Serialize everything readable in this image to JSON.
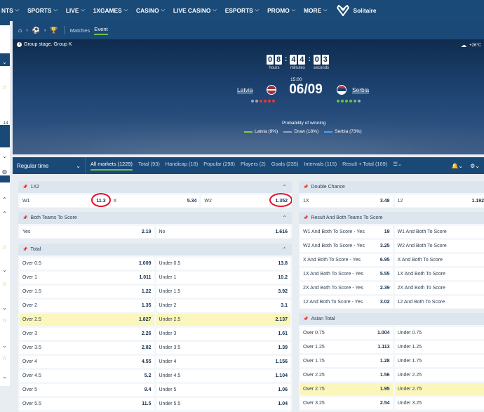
{
  "nav": {
    "items": [
      {
        "label": "NTS",
        "chev": "v"
      },
      {
        "label": "SPORTS",
        "chev": "v"
      },
      {
        "label": "LIVE",
        "chev": "v"
      },
      {
        "label": "1XGAMES",
        "chev": "v"
      },
      {
        "label": "CASINO",
        "chev": "v"
      },
      {
        "label": "LIVE CASINO",
        "chev": "v"
      },
      {
        "label": "ESPORTS",
        "chev": "v"
      },
      {
        "label": "PROMO",
        "chev": "v"
      },
      {
        "label": "MORE",
        "chev": "v"
      }
    ],
    "logo_label": "Solitaire"
  },
  "leftbar": {
    "badge": ".14"
  },
  "breadcrumb": {
    "home_icon": "home-icon",
    "ball_icon": "soccer-ball-icon",
    "trophy_icon": "trophy-icon",
    "tabs": [
      "Matches",
      "Event"
    ]
  },
  "event": {
    "group": "Group stage. Group K",
    "weather": "+26°C",
    "clock": {
      "hours": [
        "0",
        "8"
      ],
      "minutes": [
        "4",
        "4"
      ],
      "seconds": [
        "0",
        "3"
      ],
      "labels": [
        "hours",
        "minutes",
        "seconds"
      ]
    },
    "kickoff": "15:00",
    "home": "Latvia",
    "away": "Serbia",
    "date": "06/09",
    "probability_title": "Probability of winning",
    "legend": [
      {
        "label": "Latvia (9%)",
        "color": "#8bc34a"
      },
      {
        "label": "Draw (18%)",
        "color": "#90a4c4"
      },
      {
        "label": "Serbia (73%)",
        "color": "#42a5f5"
      }
    ],
    "home_form": [
      "#9aa9ba",
      "#9aa9ba",
      "#e53935",
      "#e53935",
      "#e53935",
      "#e53935"
    ],
    "away_form": [
      "#6dc04b",
      "#6dc04b",
      "#6dc04b",
      "#6dc04b",
      "#6dc04b",
      "#9aa9ba"
    ]
  },
  "market_bar": {
    "period": "Regular time",
    "tabs": [
      "All markets (1229)",
      "Total (93)",
      "Handicap (18)",
      "Popular (298)",
      "Players (2)",
      "Goals (235)",
      "Intervals (115)",
      "Result + Total (169)"
    ]
  },
  "panels": {
    "x12": {
      "title": "1X2",
      "cells": [
        [
          "W1",
          "11.3"
        ],
        [
          "X",
          "5.34"
        ],
        [
          "W2",
          "1.352"
        ]
      ]
    },
    "btts": {
      "title": "Both Teams To Score",
      "cells": [
        [
          "Yes",
          "2.19"
        ],
        [
          "No",
          "1.616"
        ]
      ]
    },
    "total": {
      "title": "Total",
      "rows": [
        [
          [
            "Over 0.5",
            "1.009"
          ],
          [
            "Under 0.5",
            "13.8"
          ]
        ],
        [
          [
            "Over 1",
            "1.011"
          ],
          [
            "Under 1",
            "10.2"
          ]
        ],
        [
          [
            "Over 1.5",
            "1.22"
          ],
          [
            "Under 1.5",
            "3.92"
          ]
        ],
        [
          [
            "Over 2",
            "1.35"
          ],
          [
            "Under 2",
            "3.1"
          ]
        ],
        [
          [
            "Over 2.5",
            "1.827"
          ],
          [
            "Under 2.5",
            "2.137"
          ]
        ],
        [
          [
            "Over 3",
            "2.26"
          ],
          [
            "Under 3",
            "1.61"
          ]
        ],
        [
          [
            "Over 3.5",
            "2.82"
          ],
          [
            "Under 3.5",
            "1.39"
          ]
        ],
        [
          [
            "Over 4",
            "4.55"
          ],
          [
            "Under 4",
            "1.156"
          ]
        ],
        [
          [
            "Over 4.5",
            "5.2"
          ],
          [
            "Under 4.5",
            "1.104"
          ]
        ],
        [
          [
            "Over 5",
            "9.4"
          ],
          [
            "Under 5",
            "1.06"
          ]
        ],
        [
          [
            "Over 5.5",
            "11.5"
          ],
          [
            "Under 5.5",
            "1.04"
          ]
        ]
      ]
    },
    "double": {
      "title": "Double Chance",
      "cells": [
        [
          "1X",
          "3.48"
        ],
        [
          "12",
          "1.192"
        ]
      ]
    },
    "rbtts": {
      "title": "Result And Both Teams To Score",
      "rows": [
        [
          [
            "W1 And Both To Score - Yes",
            "19"
          ],
          [
            "W1 And Both To Score",
            ""
          ]
        ],
        [
          [
            "W2 And Both To Score - Yes",
            "3.25"
          ],
          [
            "W2 And Both To Score",
            ""
          ]
        ],
        [
          [
            "X And Both To Score - Yes",
            "6.95"
          ],
          [
            "X And Both To Score",
            ""
          ]
        ],
        [
          [
            "1X And Both To Score - Yes",
            "5.55"
          ],
          [
            "1X And Both To Score",
            ""
          ]
        ],
        [
          [
            "2X And Both To Score - Yes",
            "2.39"
          ],
          [
            "2X And Both To Score",
            ""
          ]
        ],
        [
          [
            "12 And Both To Score - Yes",
            "3.02"
          ],
          [
            "12 And Both To Score",
            ""
          ]
        ]
      ]
    },
    "asian": {
      "title": "Asian Total",
      "rows": [
        [
          [
            "Over 0.75",
            "1.004"
          ],
          [
            "Under 0.75",
            ""
          ]
        ],
        [
          [
            "Over 1.25",
            "1.113"
          ],
          [
            "Under 1.25",
            ""
          ]
        ],
        [
          [
            "Over 1.75",
            "1.28"
          ],
          [
            "Under 1.75",
            ""
          ]
        ],
        [
          [
            "Over 2.25",
            "1.56"
          ],
          [
            "Under 2.25",
            ""
          ]
        ],
        [
          [
            "Over 2.75",
            "1.95"
          ],
          [
            "Under 2.75",
            ""
          ]
        ],
        [
          [
            "Over 3.25",
            "2.54"
          ],
          [
            "Under 3.25",
            ""
          ]
        ]
      ]
    }
  },
  "colors": {
    "highlight": "#fbf6bb",
    "annotation": "#e3122a",
    "accent": "#6dc04b"
  }
}
